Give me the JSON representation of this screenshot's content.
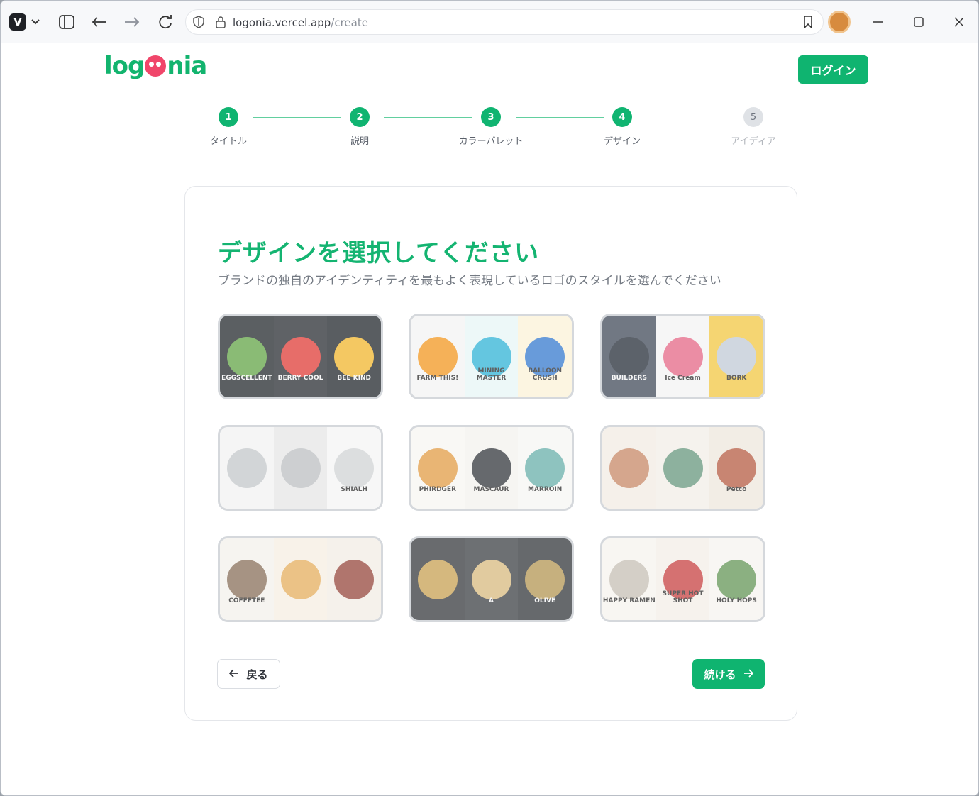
{
  "browser": {
    "url_host": "logonia.vercel.app",
    "url_path": "/create"
  },
  "header": {
    "brand_left": "log",
    "brand_right": "nia",
    "login_label": "ログイン"
  },
  "steps": [
    {
      "num": "1",
      "label": "タイトル",
      "status": "done"
    },
    {
      "num": "2",
      "label": "説明",
      "status": "done"
    },
    {
      "num": "3",
      "label": "カラーパレット",
      "status": "done"
    },
    {
      "num": "4",
      "label": "デザイン",
      "status": "current"
    },
    {
      "num": "5",
      "label": "アイディア",
      "status": "pending"
    }
  ],
  "main": {
    "title": "デザインを選択してください",
    "subtitle": "ブランドの独自のアイデンティティを最もよく表現しているロゴのスタイルを選んでください"
  },
  "designs": [
    {
      "name": "mascot",
      "cells": [
        {
          "bg": "#2e3337",
          "art": "#6aa84f",
          "text": "EGGSCELLENT"
        },
        {
          "bg": "#32373b",
          "art": "#e0443f",
          "text": "BERRY COOL"
        },
        {
          "bg": "#2b3035",
          "art": "#f1b936",
          "text": "BEE KIND"
        }
      ]
    },
    {
      "name": "app-icon",
      "cells": [
        {
          "bg": "#f4f4f4",
          "art": "#f39b2a",
          "text": "FARM THIS!"
        },
        {
          "bg": "#e8f6f7",
          "art": "#39b6d8",
          "text": "MINING MASTER"
        },
        {
          "bg": "#fbf3d9",
          "art": "#3e7fd0",
          "text": "BALLOON CRUSH"
        }
      ]
    },
    {
      "name": "badge",
      "cells": [
        {
          "bg": "#4a5260",
          "art": "#2f3640",
          "text": "BUILDERS"
        },
        {
          "bg": "#f4f4f4",
          "art": "#e66d8b",
          "text": "Ice Cream"
        },
        {
          "bg": "#f3c94b",
          "art": "#c3ccd8",
          "text": "BORK"
        }
      ]
    },
    {
      "name": "line-art",
      "cells": [
        {
          "bg": "#f2f2f2",
          "art": "#c6c9cc",
          "text": ""
        },
        {
          "bg": "#e7e7e7",
          "art": "#bfc2c5",
          "text": ""
        },
        {
          "bg": "#f5f5f5",
          "art": "#d3d5d7",
          "text": "SHIALH"
        }
      ]
    },
    {
      "name": "minimal",
      "cells": [
        {
          "bg": "#f8f6f2",
          "art": "#e3a04e",
          "text": "PHIRDGER"
        },
        {
          "bg": "#f4f2ef",
          "art": "#3b3f45",
          "text": "MASCAUR"
        },
        {
          "bg": "#f7f6f4",
          "art": "#6fb3ae",
          "text": "MARROIN"
        }
      ]
    },
    {
      "name": "emblem",
      "cells": [
        {
          "bg": "#f2ece4",
          "art": "#c98e6d",
          "text": ""
        },
        {
          "bg": "#f3efe8",
          "art": "#6e9c83",
          "text": ""
        },
        {
          "bg": "#efe8de",
          "art": "#b9634b",
          "text": "Petco"
        }
      ]
    },
    {
      "name": "vintage",
      "cells": [
        {
          "bg": "#f4f1ec",
          "art": "#8d7560",
          "text": "COFFFTEE"
        },
        {
          "bg": "#f6efe3",
          "art": "#e6b165",
          "text": ""
        },
        {
          "bg": "#f2ede6",
          "art": "#9a4f45",
          "text": ""
        }
      ]
    },
    {
      "name": "luxury",
      "cells": [
        {
          "bg": "#3f4246",
          "art": "#c9a55a",
          "text": ""
        },
        {
          "bg": "#45484c",
          "art": "#d9bd85",
          "text": "Ā"
        },
        {
          "bg": "#3c3f43",
          "art": "#b79a5a",
          "text": "OLIVE"
        }
      ]
    },
    {
      "name": "retro",
      "cells": [
        {
          "bg": "#f7f4ef",
          "art": "#c8c2b8",
          "text": "HAPPY RAMEN"
        },
        {
          "bg": "#f4efe8",
          "art": "#c94a4a",
          "text": "SUPER HOT SHOT"
        },
        {
          "bg": "#f6f4f0",
          "art": "#6b9a5e",
          "text": "HOLY HOPS"
        }
      ]
    }
  ],
  "actions": {
    "back_label": "戻る",
    "continue_label": "続ける"
  }
}
